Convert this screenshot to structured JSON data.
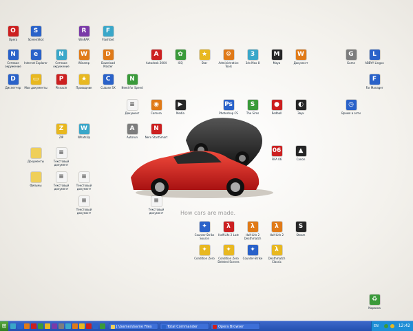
{
  "wallpaper": {
    "tagline": "How cars are made.",
    "colors": {
      "red_car": "#cc1c1c",
      "black_car": "#1a1a1a",
      "background": "#f3f1ec"
    }
  },
  "desktop_icons": [
    {
      "id": "opera",
      "label": "Opera",
      "icon": "opera-icon",
      "color": "red",
      "glyph": "O"
    },
    {
      "id": "icon-t2",
      "label": "ScreenShot",
      "icon": "app-icon",
      "color": "blue",
      "glyph": "S"
    },
    {
      "id": "winrar",
      "label": "WinRAR",
      "icon": "winrar-icon",
      "color": "purple",
      "glyph": "R"
    },
    {
      "id": "flashget",
      "label": "FlashGet",
      "icon": "flashget-icon",
      "color": "cyan",
      "glyph": "F"
    },
    {
      "id": "net-env",
      "label": "Сетевое окружение",
      "icon": "network-icon",
      "color": "blue",
      "glyph": "N"
    },
    {
      "id": "ie",
      "label": "Internet Explorer",
      "icon": "ie-icon",
      "color": "blue",
      "glyph": "e"
    },
    {
      "id": "network",
      "label": "Сетевое окружение",
      "icon": "network-icon",
      "color": "cyan",
      "glyph": "N"
    },
    {
      "id": "winamp",
      "label": "Winamp",
      "icon": "winamp-icon",
      "color": "orange",
      "glyph": "W"
    },
    {
      "id": "dmaster",
      "label": "Download Master",
      "icon": "download-icon",
      "color": "orange",
      "glyph": "D"
    },
    {
      "id": "acad",
      "label": "Autodesk 2004",
      "icon": "autocad-icon",
      "color": "red",
      "glyph": "A"
    },
    {
      "id": "icq",
      "label": "ICQ",
      "icon": "icq-icon",
      "color": "green",
      "glyph": "✿"
    },
    {
      "id": "star",
      "label": "Star",
      "icon": "star-icon",
      "color": "yellow",
      "glyph": "★"
    },
    {
      "id": "admin",
      "label": "Administrative Tools",
      "icon": "gear-icon",
      "color": "orange",
      "glyph": "⚙"
    },
    {
      "id": "3dsmax",
      "label": "3ds Max 8",
      "icon": "3dsmax-icon",
      "color": "cyan",
      "glyph": "3"
    },
    {
      "id": "maya",
      "label": "Maya",
      "icon": "maya-icon",
      "color": "dark",
      "glyph": "M"
    },
    {
      "id": "word",
      "label": "Документ",
      "icon": "doc-icon",
      "color": "orange",
      "glyph": "W"
    },
    {
      "id": "game-r1",
      "label": "Game",
      "icon": "game-icon",
      "color": "gray",
      "glyph": "G"
    },
    {
      "id": "app-r2",
      "label": "ABBYY Lingvo",
      "icon": "app-icon",
      "color": "blue",
      "glyph": "L"
    },
    {
      "id": "mgr",
      "label": "Диспетчер",
      "icon": "manager-icon",
      "color": "blue",
      "glyph": "D"
    },
    {
      "id": "mydocs",
      "label": "Мои документы",
      "icon": "folder-icon",
      "color": "yellow",
      "glyph": "▭"
    },
    {
      "id": "pinnacle",
      "label": "Pinnacle",
      "icon": "pinnacle-icon",
      "color": "red",
      "glyph": "P"
    },
    {
      "id": "prov",
      "label": "Проводник",
      "icon": "explorer-icon",
      "color": "yellow",
      "glyph": "★"
    },
    {
      "id": "cubase",
      "label": "Cubase SX",
      "icon": "cubase-icon",
      "color": "blue",
      "glyph": "C"
    },
    {
      "id": "nfs",
      "label": "Need for Speed",
      "icon": "nfs-icon",
      "color": "green",
      "glyph": "N"
    },
    {
      "id": "fm",
      "label": "Far Manager",
      "icon": "far-icon",
      "color": "blue",
      "glyph": "F"
    },
    {
      "id": "doc1",
      "label": "Документ",
      "icon": "doc-icon",
      "color": "paper",
      "glyph": "≡"
    },
    {
      "id": "cam",
      "label": "Camera",
      "icon": "camera-icon",
      "color": "orange",
      "glyph": "◉"
    },
    {
      "id": "media",
      "label": "Media",
      "icon": "media-icon",
      "color": "dark",
      "glyph": "▶"
    },
    {
      "id": "photoshop",
      "label": "Photoshop CS",
      "icon": "photoshop-icon",
      "color": "blue",
      "glyph": "Ps"
    },
    {
      "id": "sims",
      "label": "The Sims",
      "icon": "sims-icon",
      "color": "green",
      "glyph": "S"
    },
    {
      "id": "redball",
      "label": "Redball",
      "icon": "redball-icon",
      "color": "red",
      "glyph": "●"
    },
    {
      "id": "speaker",
      "label": "Звук",
      "icon": "speaker-icon",
      "color": "dark",
      "glyph": "◐"
    },
    {
      "id": "nettime",
      "label": "Время в сети",
      "icon": "clock-icon",
      "color": "blue",
      "glyph": "◷"
    },
    {
      "id": "fifa06",
      "label": "FIFA 06",
      "icon": "fifa-icon",
      "color": "red",
      "glyph": "06"
    },
    {
      "id": "tripod",
      "label": "Canon",
      "icon": "canon-icon",
      "color": "dark",
      "glyph": "▲"
    },
    {
      "id": "nero",
      "label": "Nero StartSmart",
      "icon": "nero-icon",
      "color": "red",
      "glyph": "N"
    },
    {
      "id": "auto-mail",
      "label": "Autorun",
      "icon": "app-icon",
      "color": "gray",
      "glyph": "A"
    },
    {
      "id": "zip",
      "label": "ZIP",
      "icon": "zip-icon",
      "color": "yellow",
      "glyph": "Z"
    },
    {
      "id": "whatsup",
      "label": "WhatsUp",
      "icon": "app-icon",
      "color": "cyan",
      "glyph": "W"
    },
    {
      "id": "folder-d",
      "label": "Документы",
      "icon": "folder-icon",
      "color": "folder",
      "glyph": ""
    },
    {
      "id": "txt1",
      "label": "Текстовый документ",
      "icon": "doc-icon",
      "color": "paper",
      "glyph": "≡"
    },
    {
      "id": "folder-m",
      "label": "Фильмы",
      "icon": "folder-icon",
      "color": "folder",
      "glyph": ""
    },
    {
      "id": "txt2",
      "label": "Текстовый документ",
      "icon": "doc-icon",
      "color": "paper",
      "glyph": "≡"
    },
    {
      "id": "txt3",
      "label": "Текстовый документ",
      "icon": "doc-icon",
      "color": "paper",
      "glyph": "≡"
    },
    {
      "id": "txt4",
      "label": "Текстовый документ",
      "icon": "doc-icon",
      "color": "paper",
      "glyph": "≡"
    },
    {
      "id": "txt5",
      "label": "Текстовый документ",
      "icon": "doc-icon",
      "color": "paper",
      "glyph": "≡"
    },
    {
      "id": "cs-source",
      "label": "Counter-Strike Source",
      "icon": "cs-icon",
      "color": "blue",
      "glyph": "✦"
    },
    {
      "id": "hl2-lost",
      "label": "Half-Life 2 Lost",
      "icon": "hl2-icon",
      "color": "red",
      "glyph": "λ"
    },
    {
      "id": "hl2-dm",
      "label": "Half-Life 2 Deathmatch",
      "icon": "hl2-icon",
      "color": "orange",
      "glyph": "λ"
    },
    {
      "id": "hl2",
      "label": "Half-Life 2",
      "icon": "hl2-icon",
      "color": "orange",
      "glyph": "λ"
    },
    {
      "id": "steam",
      "label": "Steam",
      "icon": "steam-icon",
      "color": "dark",
      "glyph": "S"
    },
    {
      "id": "cs-cond",
      "label": "Condition Zero",
      "icon": "cs-icon",
      "color": "yellow",
      "glyph": "✦"
    },
    {
      "id": "cs-deleted",
      "label": "Condition Zero Deleted Scenes",
      "icon": "cs-icon",
      "color": "yellow",
      "glyph": "✦"
    },
    {
      "id": "cs-1",
      "label": "Counter-Strike",
      "icon": "cs-icon",
      "color": "blue",
      "glyph": "✦"
    },
    {
      "id": "hl-dmc",
      "label": "Deathmatch Classic",
      "icon": "hl2-icon",
      "color": "yellow",
      "glyph": "λ"
    },
    {
      "id": "recycle",
      "label": "Корзина",
      "icon": "recycle-bin-icon",
      "color": "green",
      "glyph": "♻"
    }
  ],
  "taskbar": {
    "start_label": "⊞",
    "tasks": [
      {
        "label": "J:\\Games\\Game Files",
        "icon": "folder-icon",
        "color": "#efcf5a"
      },
      {
        "label": "Total Commander",
        "icon": "app-icon",
        "color": "#2a62c9"
      },
      {
        "label": "Opera Browser",
        "icon": "opera-icon",
        "color": "#cc2020"
      }
    ],
    "lang": "EN",
    "clock": "12:42"
  },
  "colors": {
    "red": "#cc2020",
    "blue": "#2a62c9",
    "green": "#3a9a3a",
    "yellow": "#e8b820",
    "orange": "#e07a18",
    "gray": "#7d7d7d",
    "dark": "#262626",
    "cyan": "#3aa7c9",
    "purple": "#7a3aa8",
    "paper": "#f4f4f4",
    "folder": "#efcf5a"
  }
}
